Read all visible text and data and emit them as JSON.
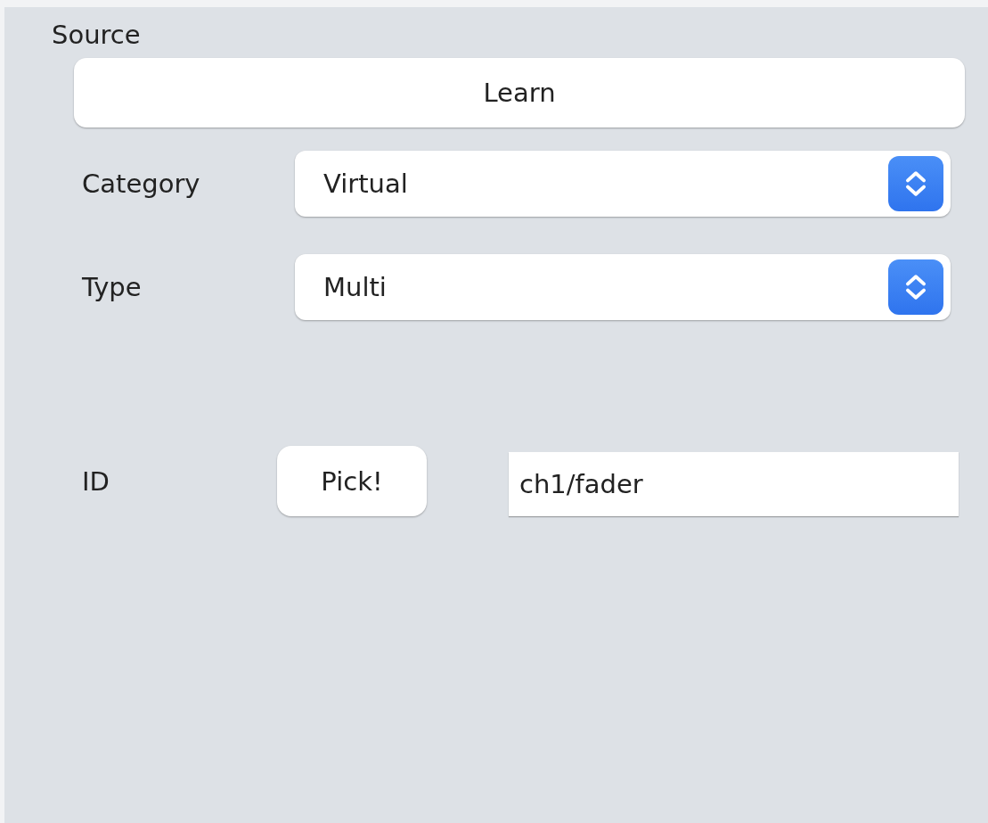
{
  "section_title": "Source",
  "learn_button": "Learn",
  "selects": [
    {
      "label": "Category",
      "value": "Virtual"
    },
    {
      "label": "Type",
      "value": "Multi"
    }
  ],
  "id_row": {
    "label": "ID",
    "button": "Pick!",
    "value": "ch1/fader"
  }
}
